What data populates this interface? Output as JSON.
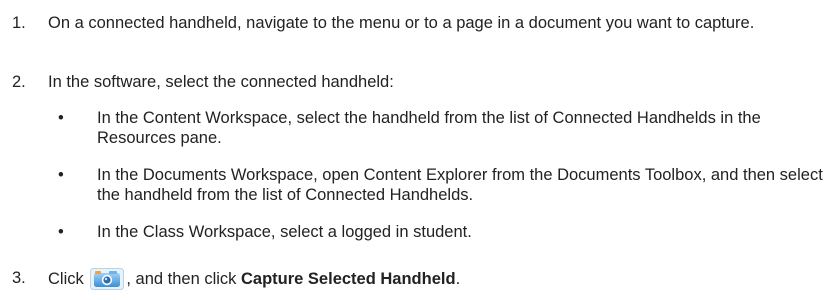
{
  "steps": [
    {
      "number": "1.",
      "text": "On a connected handheld, navigate to the menu or to a page in a document you want to capture."
    },
    {
      "number": "2.",
      "text": "In the software, select the connected handheld:",
      "bullets": [
        "In the Content Workspace, select the handheld from the list of Connected Handhelds in the Resources pane.",
        "In the Documents Workspace, open Content Explorer from the Documents Toolbox, and then select the handheld from the list of Connected Handhelds.",
        "In the Class Workspace, select a logged in student."
      ]
    },
    {
      "number": "3.",
      "text_before": "Click",
      "text_middle": ", and then click",
      "bold_text": "Capture Selected Handheld",
      "text_after": "."
    }
  ],
  "bullet_char": "•",
  "icons": {
    "capture_button": "camera-icon"
  },
  "colors": {
    "text": "#222222",
    "camera_blue": "#3a8fd6",
    "camera_orange": "#f2a33a"
  }
}
